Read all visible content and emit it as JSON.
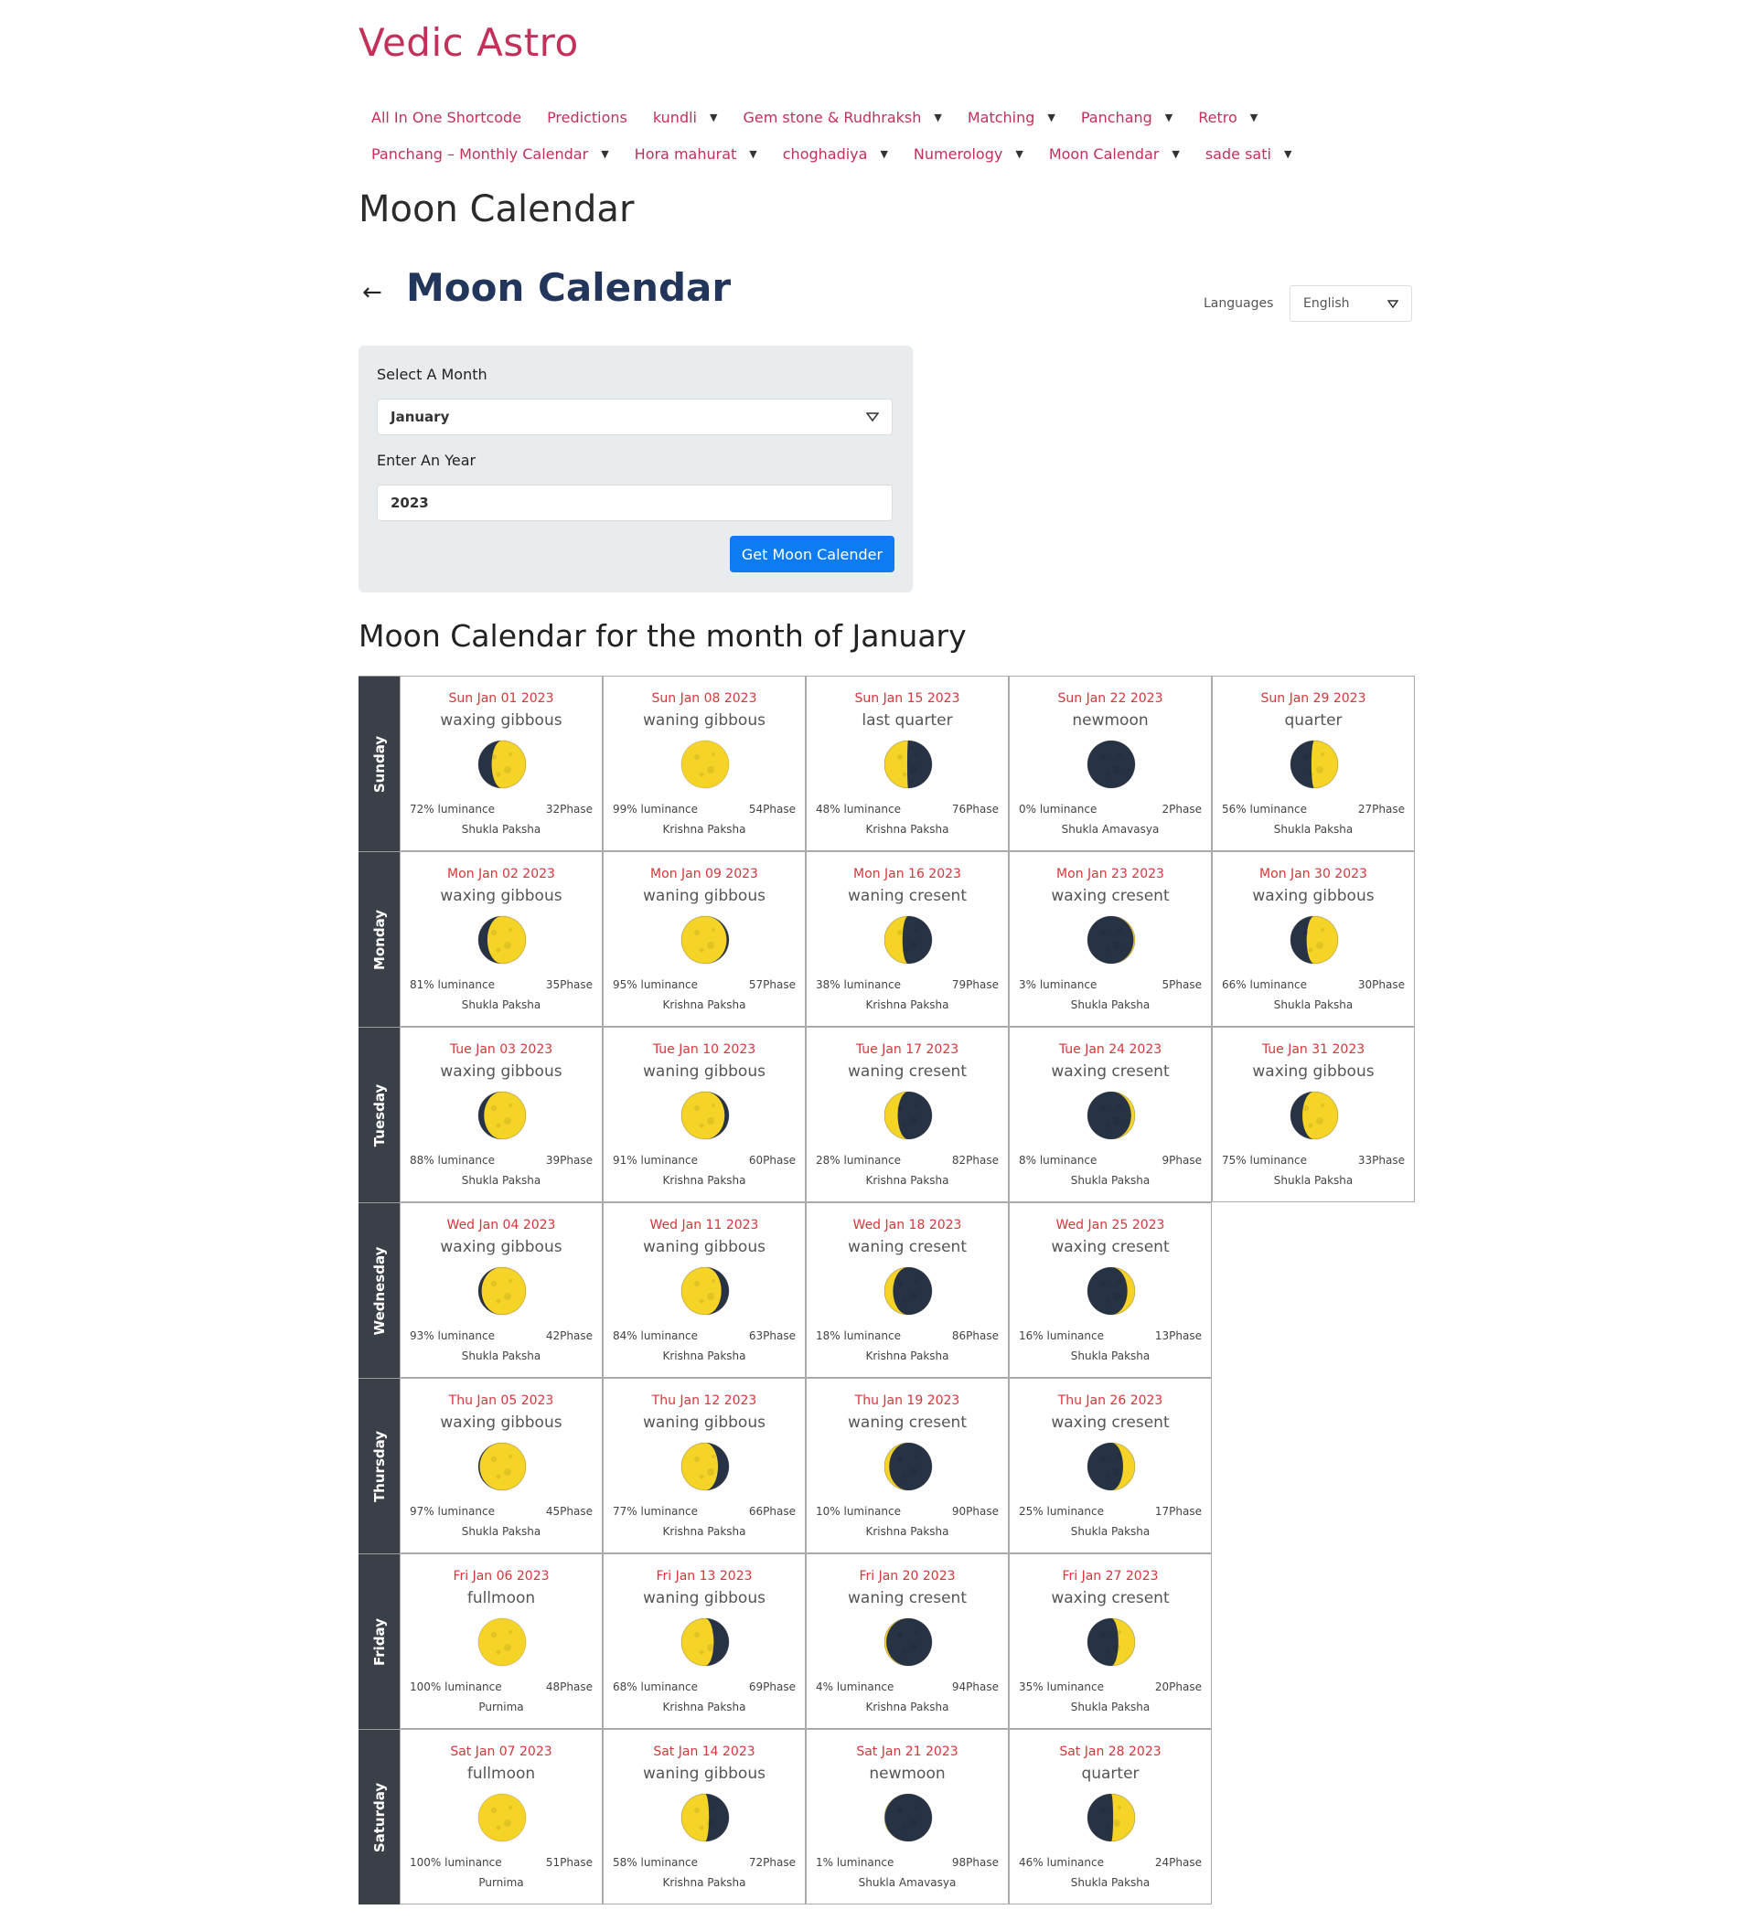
{
  "site_title": "Vedic Astro",
  "nav": {
    "row1": [
      {
        "label": "All In One Shortcode",
        "dropdown": false
      },
      {
        "label": "Predictions",
        "dropdown": false
      },
      {
        "label": "kundli",
        "dropdown": true
      },
      {
        "label": "Gem stone & Rudhraksh",
        "dropdown": true
      },
      {
        "label": "Matching",
        "dropdown": true
      },
      {
        "label": "Panchang",
        "dropdown": true
      },
      {
        "label": "Retro",
        "dropdown": true
      }
    ],
    "row2": [
      {
        "label": "Panchang – Monthly Calendar",
        "dropdown": true
      },
      {
        "label": "Hora mahurat",
        "dropdown": true
      },
      {
        "label": "choghadiya",
        "dropdown": true
      },
      {
        "label": "Numerology",
        "dropdown": true
      },
      {
        "label": "Moon Calendar",
        "dropdown": true
      },
      {
        "label": "sade sati",
        "dropdown": true
      }
    ]
  },
  "page_heading": "Moon Calendar",
  "sub_heading": "Moon Calendar",
  "languages": {
    "label": "Languages",
    "selected": "English"
  },
  "form": {
    "month_label": "Select A Month",
    "month_value": "January",
    "year_label": "Enter An Year",
    "year_value": "2023",
    "submit_label": "Get Moon Calender"
  },
  "calendar_title": "Moon Calendar for the month of January",
  "colors": {
    "accent": "#c2315a",
    "heading": "#22365c",
    "date": "#d8363a",
    "button": "#0d7cf2",
    "band": "#3b4048",
    "moon_light": "#f5d327",
    "moon_dark": "#273245"
  },
  "calendar": {
    "weekdays": [
      "Sunday",
      "Monday",
      "Tuesday",
      "Wednesday",
      "Thursday",
      "Friday",
      "Saturday"
    ],
    "days": [
      [
        {
          "date": "Sun Jan 01 2023",
          "phase": "waxing gibbous",
          "luminance": "72% luminance",
          "phase_num": "32Phase",
          "paksha": "Shukla Paksha",
          "lit": 72,
          "waxing": true
        },
        {
          "date": "Sun Jan 08 2023",
          "phase": "waning gibbous",
          "luminance": "99% luminance",
          "phase_num": "54Phase",
          "paksha": "Krishna Paksha",
          "lit": 99,
          "waxing": false
        },
        {
          "date": "Sun Jan 15 2023",
          "phase": "last quarter",
          "luminance": "48% luminance",
          "phase_num": "76Phase",
          "paksha": "Krishna Paksha",
          "lit": 48,
          "waxing": false
        },
        {
          "date": "Sun Jan 22 2023",
          "phase": "newmoon",
          "luminance": "0% luminance",
          "phase_num": "2Phase",
          "paksha": "Shukla Amavasya",
          "lit": 0,
          "waxing": true
        },
        {
          "date": "Sun Jan 29 2023",
          "phase": "quarter",
          "luminance": "56% luminance",
          "phase_num": "27Phase",
          "paksha": "Shukla Paksha",
          "lit": 56,
          "waxing": true
        }
      ],
      [
        {
          "date": "Mon Jan 02 2023",
          "phase": "waxing gibbous",
          "luminance": "81% luminance",
          "phase_num": "35Phase",
          "paksha": "Shukla Paksha",
          "lit": 81,
          "waxing": true
        },
        {
          "date": "Mon Jan 09 2023",
          "phase": "waning gibbous",
          "luminance": "95% luminance",
          "phase_num": "57Phase",
          "paksha": "Krishna Paksha",
          "lit": 95,
          "waxing": false
        },
        {
          "date": "Mon Jan 16 2023",
          "phase": "waning cresent",
          "luminance": "38% luminance",
          "phase_num": "79Phase",
          "paksha": "Krishna Paksha",
          "lit": 38,
          "waxing": false
        },
        {
          "date": "Mon Jan 23 2023",
          "phase": "waxing cresent",
          "luminance": "3% luminance",
          "phase_num": "5Phase",
          "paksha": "Shukla Paksha",
          "lit": 3,
          "waxing": true
        },
        {
          "date": "Mon Jan 30 2023",
          "phase": "waxing gibbous",
          "luminance": "66% luminance",
          "phase_num": "30Phase",
          "paksha": "Shukla Paksha",
          "lit": 66,
          "waxing": true
        }
      ],
      [
        {
          "date": "Tue Jan 03 2023",
          "phase": "waxing gibbous",
          "luminance": "88% luminance",
          "phase_num": "39Phase",
          "paksha": "Shukla Paksha",
          "lit": 88,
          "waxing": true
        },
        {
          "date": "Tue Jan 10 2023",
          "phase": "waning gibbous",
          "luminance": "91% luminance",
          "phase_num": "60Phase",
          "paksha": "Krishna Paksha",
          "lit": 91,
          "waxing": false
        },
        {
          "date": "Tue Jan 17 2023",
          "phase": "waning cresent",
          "luminance": "28% luminance",
          "phase_num": "82Phase",
          "paksha": "Krishna Paksha",
          "lit": 28,
          "waxing": false
        },
        {
          "date": "Tue Jan 24 2023",
          "phase": "waxing cresent",
          "luminance": "8% luminance",
          "phase_num": "9Phase",
          "paksha": "Shukla Paksha",
          "lit": 8,
          "waxing": true
        },
        {
          "date": "Tue Jan 31 2023",
          "phase": "waxing gibbous",
          "luminance": "75% luminance",
          "phase_num": "33Phase",
          "paksha": "Shukla Paksha",
          "lit": 75,
          "waxing": true
        }
      ],
      [
        {
          "date": "Wed Jan 04 2023",
          "phase": "waxing gibbous",
          "luminance": "93% luminance",
          "phase_num": "42Phase",
          "paksha": "Shukla Paksha",
          "lit": 93,
          "waxing": true
        },
        {
          "date": "Wed Jan 11 2023",
          "phase": "waning gibbous",
          "luminance": "84% luminance",
          "phase_num": "63Phase",
          "paksha": "Krishna Paksha",
          "lit": 84,
          "waxing": false
        },
        {
          "date": "Wed Jan 18 2023",
          "phase": "waning cresent",
          "luminance": "18% luminance",
          "phase_num": "86Phase",
          "paksha": "Krishna Paksha",
          "lit": 18,
          "waxing": false
        },
        {
          "date": "Wed Jan 25 2023",
          "phase": "waxing cresent",
          "luminance": "16% luminance",
          "phase_num": "13Phase",
          "paksha": "Shukla Paksha",
          "lit": 16,
          "waxing": true
        }
      ],
      [
        {
          "date": "Thu Jan 05 2023",
          "phase": "waxing gibbous",
          "luminance": "97% luminance",
          "phase_num": "45Phase",
          "paksha": "Shukla Paksha",
          "lit": 97,
          "waxing": true
        },
        {
          "date": "Thu Jan 12 2023",
          "phase": "waning gibbous",
          "luminance": "77% luminance",
          "phase_num": "66Phase",
          "paksha": "Krishna Paksha",
          "lit": 77,
          "waxing": false
        },
        {
          "date": "Thu Jan 19 2023",
          "phase": "waning cresent",
          "luminance": "10% luminance",
          "phase_num": "90Phase",
          "paksha": "Krishna Paksha",
          "lit": 10,
          "waxing": false
        },
        {
          "date": "Thu Jan 26 2023",
          "phase": "waxing cresent",
          "luminance": "25% luminance",
          "phase_num": "17Phase",
          "paksha": "Shukla Paksha",
          "lit": 25,
          "waxing": true
        }
      ],
      [
        {
          "date": "Fri Jan 06 2023",
          "phase": "fullmoon",
          "luminance": "100% luminance",
          "phase_num": "48Phase",
          "paksha": "Purnima",
          "lit": 100,
          "waxing": true
        },
        {
          "date": "Fri Jan 13 2023",
          "phase": "waning gibbous",
          "luminance": "68% luminance",
          "phase_num": "69Phase",
          "paksha": "Krishna Paksha",
          "lit": 68,
          "waxing": false
        },
        {
          "date": "Fri Jan 20 2023",
          "phase": "waning cresent",
          "luminance": "4% luminance",
          "phase_num": "94Phase",
          "paksha": "Krishna Paksha",
          "lit": 4,
          "waxing": false
        },
        {
          "date": "Fri Jan 27 2023",
          "phase": "waxing cresent",
          "luminance": "35% luminance",
          "phase_num": "20Phase",
          "paksha": "Shukla Paksha",
          "lit": 35,
          "waxing": true
        }
      ],
      [
        {
          "date": "Sat Jan 07 2023",
          "phase": "fullmoon",
          "luminance": "100% luminance",
          "phase_num": "51Phase",
          "paksha": "Purnima",
          "lit": 100,
          "waxing": true
        },
        {
          "date": "Sat Jan 14 2023",
          "phase": "waning gibbous",
          "luminance": "58% luminance",
          "phase_num": "72Phase",
          "paksha": "Krishna Paksha",
          "lit": 58,
          "waxing": false
        },
        {
          "date": "Sat Jan 21 2023",
          "phase": "newmoon",
          "luminance": "1% luminance",
          "phase_num": "98Phase",
          "paksha": "Shukla Amavasya",
          "lit": 1,
          "waxing": false
        },
        {
          "date": "Sat Jan 28 2023",
          "phase": "quarter",
          "luminance": "46% luminance",
          "phase_num": "24Phase",
          "paksha": "Shukla Paksha",
          "lit": 46,
          "waxing": true
        }
      ]
    ]
  }
}
